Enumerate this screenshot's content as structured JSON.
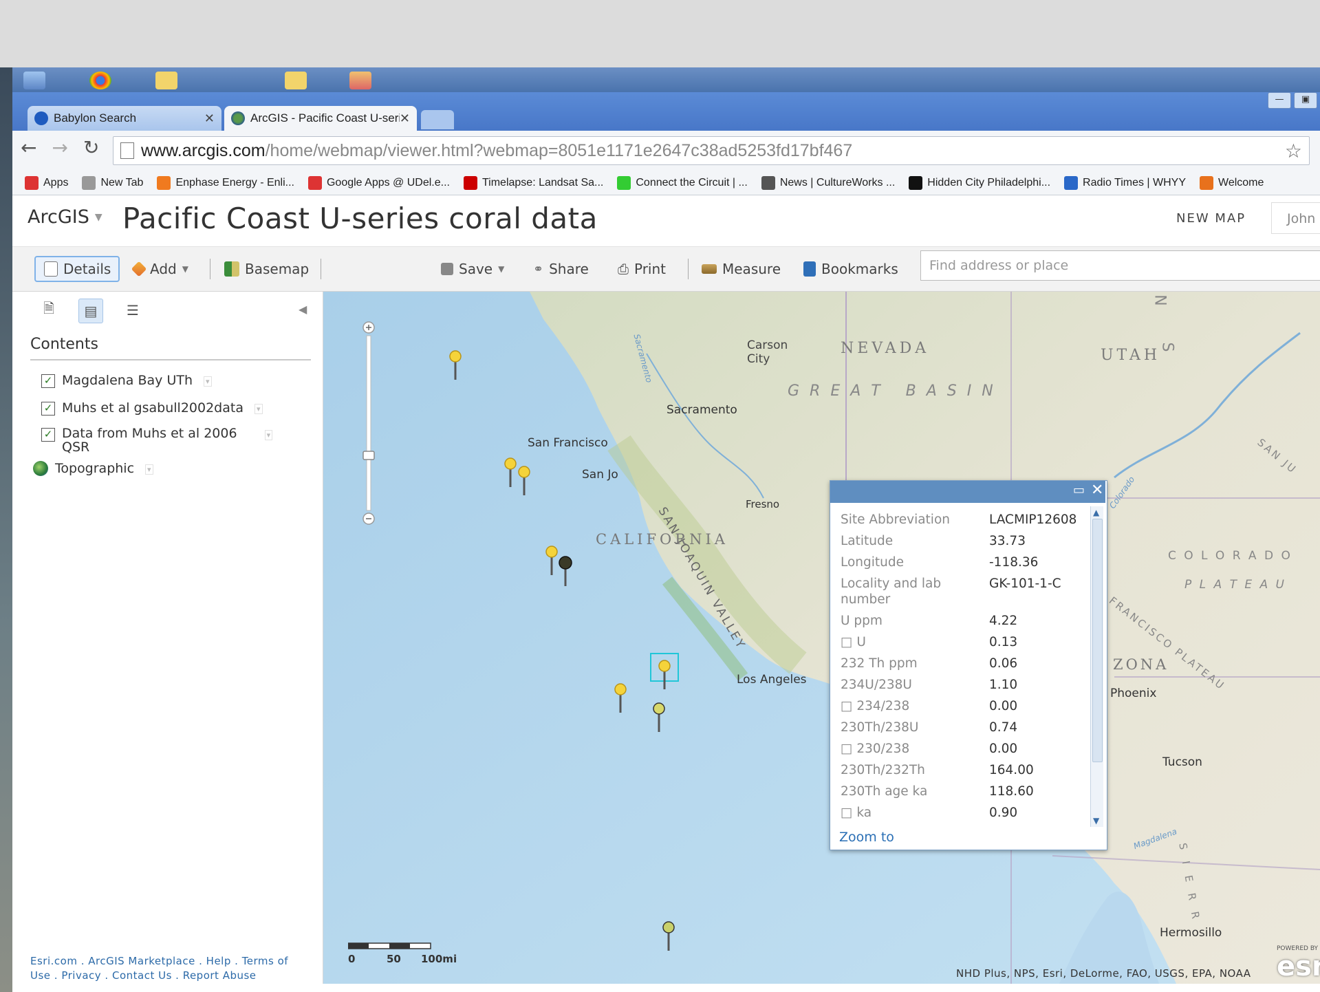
{
  "browser": {
    "tabs": [
      {
        "title": "Babylon Search"
      },
      {
        "title": "ArcGIS - Pacific Coast U-seri"
      }
    ],
    "url_host": "www.arcgis.com",
    "url_path": "/home/webmap/viewer.html?webmap=8051e1171e2647c38ad5253fd17bf467",
    "bookmarks": [
      {
        "label": "Apps",
        "icon": "apps-grid-icon",
        "color": "#d33"
      },
      {
        "label": "New Tab",
        "icon": "page-icon",
        "color": "#999"
      },
      {
        "label": "Enphase Energy - Enli...",
        "icon": "enphase-icon",
        "color": "#f07a1f"
      },
      {
        "label": "Google Apps @ UDel.e...",
        "icon": "gmail-icon",
        "color": "#d33"
      },
      {
        "label": "Timelapse: Landsat Sa...",
        "icon": "time-icon",
        "color": "#c00"
      },
      {
        "label": "Connect the Circuit | ...",
        "icon": "circuit-icon",
        "color": "#3c3"
      },
      {
        "label": "News | CultureWorks ...",
        "icon": "cultureworks-icon",
        "color": "#555"
      },
      {
        "label": "Hidden City Philadelphi...",
        "icon": "hiddencity-icon",
        "color": "#111"
      },
      {
        "label": "Radio Times | WHYY",
        "icon": "whyy-icon",
        "color": "#2a68c8"
      },
      {
        "label": "Welcome",
        "icon": "welcome-icon",
        "color": "#e8711c"
      }
    ]
  },
  "header": {
    "app_menu": "ArcGIS",
    "title": "Pacific Coast U-series coral data",
    "new_map": "NEW MAP",
    "user": "John"
  },
  "toolbar": {
    "details": "Details",
    "add": "Add",
    "basemap": "Basemap",
    "save": "Save",
    "share": "Share",
    "print": "Print",
    "measure": "Measure",
    "bookmarks": "Bookmarks",
    "search_placeholder": "Find address or place"
  },
  "contents": {
    "title": "Contents",
    "layers": [
      {
        "name": "Magdalena Bay UTh",
        "checked": true
      },
      {
        "name": "Muhs et al gsabull2002data",
        "checked": true
      },
      {
        "name": "Data from Muhs et al 2006",
        "name2": "QSR",
        "checked": true
      },
      {
        "name": "Topographic",
        "checked": false
      }
    ]
  },
  "footer": {
    "line1": [
      "Esri.com",
      "ArcGIS Marketplace",
      "Help",
      "Terms of"
    ],
    "line2": [
      "Use",
      "Privacy",
      "Contact Us",
      "Report Abuse"
    ]
  },
  "map": {
    "labels": {
      "carson": "Carson",
      "carson2": "City",
      "nevada": "NEVADA",
      "utah": "UTAH",
      "great_basin": "G R E A T   B A S I N",
      "sacramento": "Sacramento",
      "san_francisco": "San Francisco",
      "san_jose": "San Jo",
      "fresno": "Fresno",
      "san_joaquin": "SAN JOAQUIN VALLEY",
      "california": "CALIFORNIA",
      "colorado": "C O L O R A D O",
      "plateau": "P L A T E A U",
      "sf_plateau": "FRANCISCO PLATEAU",
      "arizona": "ZONA",
      "phoenix": "Phoenix",
      "los_angeles": "Los Angeles",
      "tucson": "Tucson",
      "hermosillo": "Hermosillo",
      "sacramento_r": "Sacramento",
      "colorado_r": "Colorado",
      "n_letter": "N",
      "s_letter": "S",
      "sanju": "SAN JU",
      "magdalena": "Magdalena",
      "sierra": "S I E R R"
    },
    "scale": {
      "ticks": [
        "0",
        "50",
        "100mi"
      ]
    },
    "attribution": "NHD Plus, NPS, Esri, DeLorme, FAO, USGS, EPA, NOAA",
    "powered": "POWERED BY",
    "esri": "esri"
  },
  "popup": {
    "rows": [
      {
        "k": "Site Abbreviation",
        "v": "LACMIP12608"
      },
      {
        "k": "Latitude",
        "v": "33.73"
      },
      {
        "k": "Longitude",
        "v": "-118.36"
      },
      {
        "k": "Locality and lab number",
        "v": "GK-101-1-C"
      },
      {
        "k": "U ppm",
        "v": "4.22"
      },
      {
        "k": "□ U",
        "v": "0.13"
      },
      {
        "k": "232 Th ppm",
        "v": "0.06"
      },
      {
        "k": "234U/238U",
        "v": "1.10"
      },
      {
        "k": "□ 234/238",
        "v": "0.00"
      },
      {
        "k": "230Th/238U",
        "v": "0.74"
      },
      {
        "k": "□ 230/238",
        "v": "0.00"
      },
      {
        "k": "230Th/232Th",
        "v": "164.00"
      },
      {
        "k": "230Th age ka",
        "v": "118.60"
      },
      {
        "k": "□ ka",
        "v": "0.90"
      }
    ],
    "zoom_to": "Zoom to"
  }
}
